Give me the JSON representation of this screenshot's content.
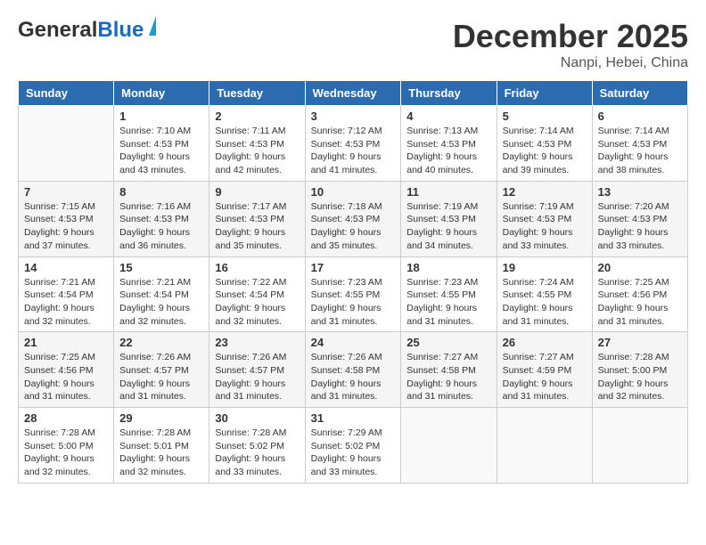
{
  "header": {
    "logo_general": "General",
    "logo_blue": "Blue",
    "month_title": "December 2025",
    "location": "Nanpi, Hebei, China"
  },
  "days_of_week": [
    "Sunday",
    "Monday",
    "Tuesday",
    "Wednesday",
    "Thursday",
    "Friday",
    "Saturday"
  ],
  "weeks": [
    [
      {
        "day": "",
        "info": ""
      },
      {
        "day": "1",
        "info": "Sunrise: 7:10 AM\nSunset: 4:53 PM\nDaylight: 9 hours\nand 43 minutes."
      },
      {
        "day": "2",
        "info": "Sunrise: 7:11 AM\nSunset: 4:53 PM\nDaylight: 9 hours\nand 42 minutes."
      },
      {
        "day": "3",
        "info": "Sunrise: 7:12 AM\nSunset: 4:53 PM\nDaylight: 9 hours\nand 41 minutes."
      },
      {
        "day": "4",
        "info": "Sunrise: 7:13 AM\nSunset: 4:53 PM\nDaylight: 9 hours\nand 40 minutes."
      },
      {
        "day": "5",
        "info": "Sunrise: 7:14 AM\nSunset: 4:53 PM\nDaylight: 9 hours\nand 39 minutes."
      },
      {
        "day": "6",
        "info": "Sunrise: 7:14 AM\nSunset: 4:53 PM\nDaylight: 9 hours\nand 38 minutes."
      }
    ],
    [
      {
        "day": "7",
        "info": "Sunrise: 7:15 AM\nSunset: 4:53 PM\nDaylight: 9 hours\nand 37 minutes."
      },
      {
        "day": "8",
        "info": "Sunrise: 7:16 AM\nSunset: 4:53 PM\nDaylight: 9 hours\nand 36 minutes."
      },
      {
        "day": "9",
        "info": "Sunrise: 7:17 AM\nSunset: 4:53 PM\nDaylight: 9 hours\nand 35 minutes."
      },
      {
        "day": "10",
        "info": "Sunrise: 7:18 AM\nSunset: 4:53 PM\nDaylight: 9 hours\nand 35 minutes."
      },
      {
        "day": "11",
        "info": "Sunrise: 7:19 AM\nSunset: 4:53 PM\nDaylight: 9 hours\nand 34 minutes."
      },
      {
        "day": "12",
        "info": "Sunrise: 7:19 AM\nSunset: 4:53 PM\nDaylight: 9 hours\nand 33 minutes."
      },
      {
        "day": "13",
        "info": "Sunrise: 7:20 AM\nSunset: 4:53 PM\nDaylight: 9 hours\nand 33 minutes."
      }
    ],
    [
      {
        "day": "14",
        "info": "Sunrise: 7:21 AM\nSunset: 4:54 PM\nDaylight: 9 hours\nand 32 minutes."
      },
      {
        "day": "15",
        "info": "Sunrise: 7:21 AM\nSunset: 4:54 PM\nDaylight: 9 hours\nand 32 minutes."
      },
      {
        "day": "16",
        "info": "Sunrise: 7:22 AM\nSunset: 4:54 PM\nDaylight: 9 hours\nand 32 minutes."
      },
      {
        "day": "17",
        "info": "Sunrise: 7:23 AM\nSunset: 4:55 PM\nDaylight: 9 hours\nand 31 minutes."
      },
      {
        "day": "18",
        "info": "Sunrise: 7:23 AM\nSunset: 4:55 PM\nDaylight: 9 hours\nand 31 minutes."
      },
      {
        "day": "19",
        "info": "Sunrise: 7:24 AM\nSunset: 4:55 PM\nDaylight: 9 hours\nand 31 minutes."
      },
      {
        "day": "20",
        "info": "Sunrise: 7:25 AM\nSunset: 4:56 PM\nDaylight: 9 hours\nand 31 minutes."
      }
    ],
    [
      {
        "day": "21",
        "info": "Sunrise: 7:25 AM\nSunset: 4:56 PM\nDaylight: 9 hours\nand 31 minutes."
      },
      {
        "day": "22",
        "info": "Sunrise: 7:26 AM\nSunset: 4:57 PM\nDaylight: 9 hours\nand 31 minutes."
      },
      {
        "day": "23",
        "info": "Sunrise: 7:26 AM\nSunset: 4:57 PM\nDaylight: 9 hours\nand 31 minutes."
      },
      {
        "day": "24",
        "info": "Sunrise: 7:26 AM\nSunset: 4:58 PM\nDaylight: 9 hours\nand 31 minutes."
      },
      {
        "day": "25",
        "info": "Sunrise: 7:27 AM\nSunset: 4:58 PM\nDaylight: 9 hours\nand 31 minutes."
      },
      {
        "day": "26",
        "info": "Sunrise: 7:27 AM\nSunset: 4:59 PM\nDaylight: 9 hours\nand 31 minutes."
      },
      {
        "day": "27",
        "info": "Sunrise: 7:28 AM\nSunset: 5:00 PM\nDaylight: 9 hours\nand 32 minutes."
      }
    ],
    [
      {
        "day": "28",
        "info": "Sunrise: 7:28 AM\nSunset: 5:00 PM\nDaylight: 9 hours\nand 32 minutes."
      },
      {
        "day": "29",
        "info": "Sunrise: 7:28 AM\nSunset: 5:01 PM\nDaylight: 9 hours\nand 32 minutes."
      },
      {
        "day": "30",
        "info": "Sunrise: 7:28 AM\nSunset: 5:02 PM\nDaylight: 9 hours\nand 33 minutes."
      },
      {
        "day": "31",
        "info": "Sunrise: 7:29 AM\nSunset: 5:02 PM\nDaylight: 9 hours\nand 33 minutes."
      },
      {
        "day": "",
        "info": ""
      },
      {
        "day": "",
        "info": ""
      },
      {
        "day": "",
        "info": ""
      }
    ]
  ]
}
